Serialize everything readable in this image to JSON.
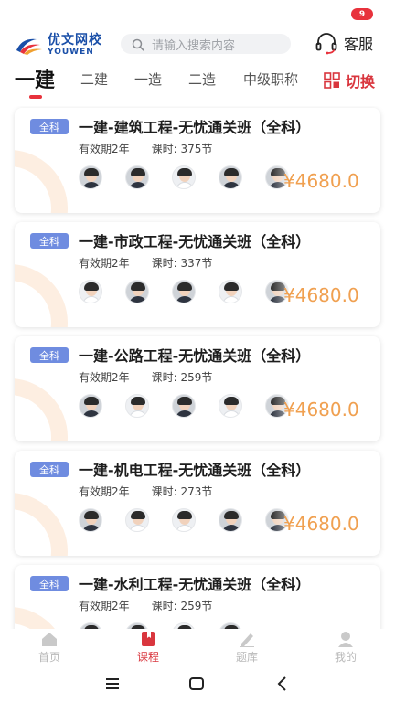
{
  "header": {
    "logo_cn": "优文网校",
    "logo_en": "YOUWEN",
    "search_placeholder": "请输入搜索内容",
    "notification_count": "9",
    "service_label": "客服",
    "colors": {
      "brand_blue": "#1a4fa8",
      "accent_red": "#d9363e",
      "badge_red": "#e8323c"
    }
  },
  "tabs": {
    "items": [
      "一建",
      "二建",
      "一造",
      "二造",
      "中级职称"
    ],
    "active_index": 0,
    "switch_label": "切换",
    "switch_icon": "grid-switch-icon"
  },
  "courses": [
    {
      "tag": "全科",
      "title": "一建-建筑工程-无忧通关班（全科）",
      "validity": "有效期2年",
      "lessons": "课时: 375节",
      "price": "¥4680.0"
    },
    {
      "tag": "全科",
      "title": "一建-市政工程-无忧通关班（全科）",
      "validity": "有效期2年",
      "lessons": "课时: 337节",
      "price": "¥4680.0"
    },
    {
      "tag": "全科",
      "title": "一建-公路工程-无忧通关班（全科）",
      "validity": "有效期2年",
      "lessons": "课时: 259节",
      "price": "¥4680.0"
    },
    {
      "tag": "全科",
      "title": "一建-机电工程-无忧通关班（全科）",
      "validity": "有效期2年",
      "lessons": "课时: 273节",
      "price": "¥4680.0"
    },
    {
      "tag": "全科",
      "title": "一建-水利工程-无忧通关班（全科）",
      "validity": "有效期2年",
      "lessons": "课时: 259节",
      "price": ""
    }
  ],
  "course_colors": {
    "tag_bg": "#6f8ce0",
    "price": "#f0a050",
    "deco_ring": "#fdeee1"
  },
  "bottom_nav": {
    "items": [
      {
        "label": "首页",
        "icon": "home-icon"
      },
      {
        "label": "课程",
        "icon": "course-book-icon"
      },
      {
        "label": "题库",
        "icon": "question-bank-pen-icon"
      },
      {
        "label": "我的",
        "icon": "profile-icon"
      }
    ],
    "active_index": 1
  },
  "system_nav": {
    "icons": [
      "menu-icon",
      "home-square-icon",
      "back-icon"
    ]
  }
}
